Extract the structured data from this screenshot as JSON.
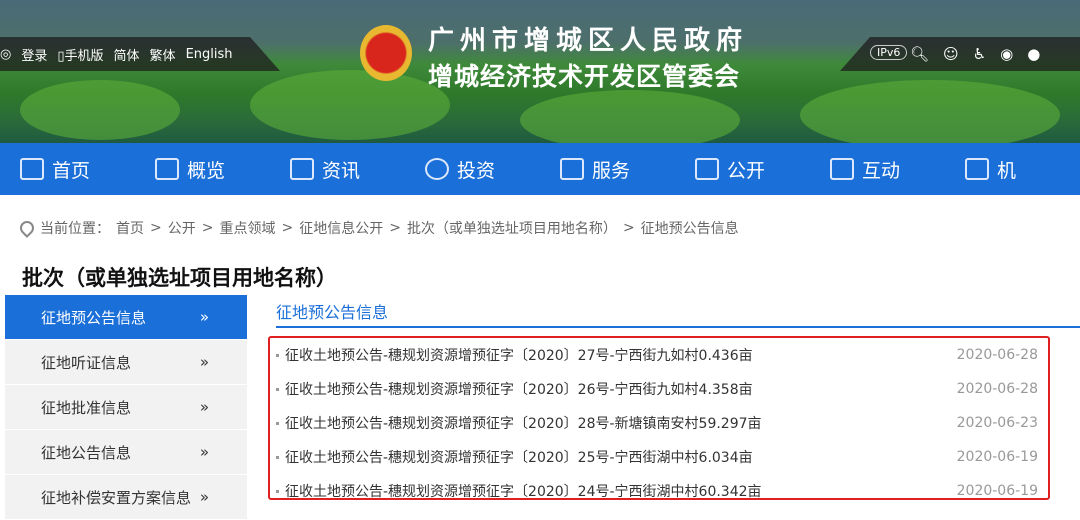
{
  "topbar": {
    "login": "登录",
    "mobile": "手机版",
    "simplified": "简体",
    "traditional": "繁体",
    "english": "English",
    "ipv6": "IPv6"
  },
  "site": {
    "title_line1": "广州市增城区人民政府",
    "title_line2": "增城经济技术开发区管委会"
  },
  "nav": [
    "首页",
    "概览",
    "资讯",
    "投资",
    "服务",
    "公开",
    "互动",
    "机"
  ],
  "breadcrumb": {
    "label": "当前位置：",
    "items": [
      "首页",
      "公开",
      "重点领域",
      "征地信息公开",
      "批次（或单独选址项目用地名称）",
      "征地预公告信息"
    ]
  },
  "page_title": "批次（或单独选址项目用地名称）",
  "sidebar": [
    "征地预公告信息",
    "征地听证信息",
    "征地批准信息",
    "征地公告信息",
    "征地补偿安置方案信息"
  ],
  "tab": "征地预公告信息",
  "rows": [
    {
      "title": "征收土地预公告-穗规划资源增预征字〔2020〕27号-宁西街九如村0.436亩",
      "date": "2020-06-28"
    },
    {
      "title": "征收土地预公告-穗规划资源增预征字〔2020〕26号-宁西街九如村4.358亩",
      "date": "2020-06-28"
    },
    {
      "title": "征收土地预公告-穗规划资源增预征字〔2020〕28号-新塘镇南安村59.297亩",
      "date": "2020-06-23"
    },
    {
      "title": "征收土地预公告-穗规划资源增预征字〔2020〕25号-宁西街湖中村6.034亩",
      "date": "2020-06-19"
    },
    {
      "title": "征收土地预公告-穗规划资源增预征字〔2020〕24号-宁西街湖中村60.342亩",
      "date": "2020-06-19"
    }
  ]
}
